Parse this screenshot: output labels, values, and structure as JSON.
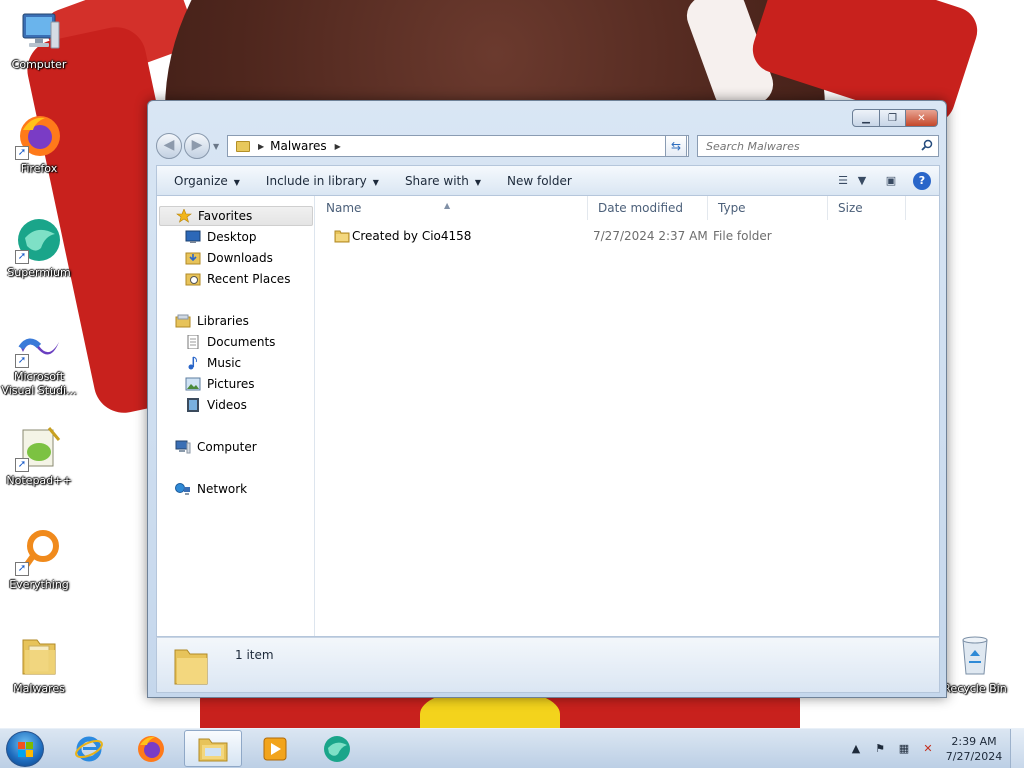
{
  "desktop": {
    "icons": [
      {
        "label": "Computer",
        "icon": "computer-icon"
      },
      {
        "label": "Firefox",
        "icon": "firefox-icon"
      },
      {
        "label": "Supermium",
        "icon": "supermium-icon"
      },
      {
        "label": "Microsoft Visual Studi...",
        "icon": "visual-studio-icon"
      },
      {
        "label": "Notepad++",
        "icon": "notepad-plus-plus-icon"
      },
      {
        "label": "Everything",
        "icon": "everything-icon"
      },
      {
        "label": "Malwares",
        "icon": "folder-icon"
      },
      {
        "label": "Recycle Bin",
        "icon": "recycle-bin-icon"
      }
    ]
  },
  "window": {
    "caption": {
      "minimize": "minimize",
      "maximize": "maximize",
      "close": "close"
    },
    "address": {
      "crumbs": [
        "Malwares"
      ]
    },
    "search": {
      "placeholder": "Search Malwares"
    },
    "toolbar": {
      "organize": "Organize",
      "include_in_library": "Include in library",
      "share_with": "Share with",
      "new_folder": "New folder"
    },
    "nav": {
      "favorites": "Favorites",
      "desktop": "Desktop",
      "downloads": "Downloads",
      "recent_places": "Recent Places",
      "libraries": "Libraries",
      "documents": "Documents",
      "music": "Music",
      "pictures": "Pictures",
      "videos": "Videos",
      "computer": "Computer",
      "network": "Network"
    },
    "columns": {
      "name": "Name",
      "date_modified": "Date modified",
      "type": "Type",
      "size": "Size"
    },
    "files": [
      {
        "name": "Created by Cio4158",
        "date_modified": "7/27/2024 2:37 AM",
        "type": "File folder",
        "size": ""
      }
    ],
    "status": {
      "item_count": "1 item"
    }
  },
  "taskbar": {
    "pinned": [
      "internet-explorer-icon",
      "firefox-icon",
      "file-explorer-icon",
      "media-player-icon",
      "supermium-icon"
    ],
    "active": "file-explorer-icon",
    "clock": {
      "time": "2:39 AM",
      "date": "7/27/2024"
    }
  },
  "colors": {
    "accent": "#2a66c9",
    "window_frame": "#c5d7ec",
    "taskbar": "#bccfe5"
  }
}
